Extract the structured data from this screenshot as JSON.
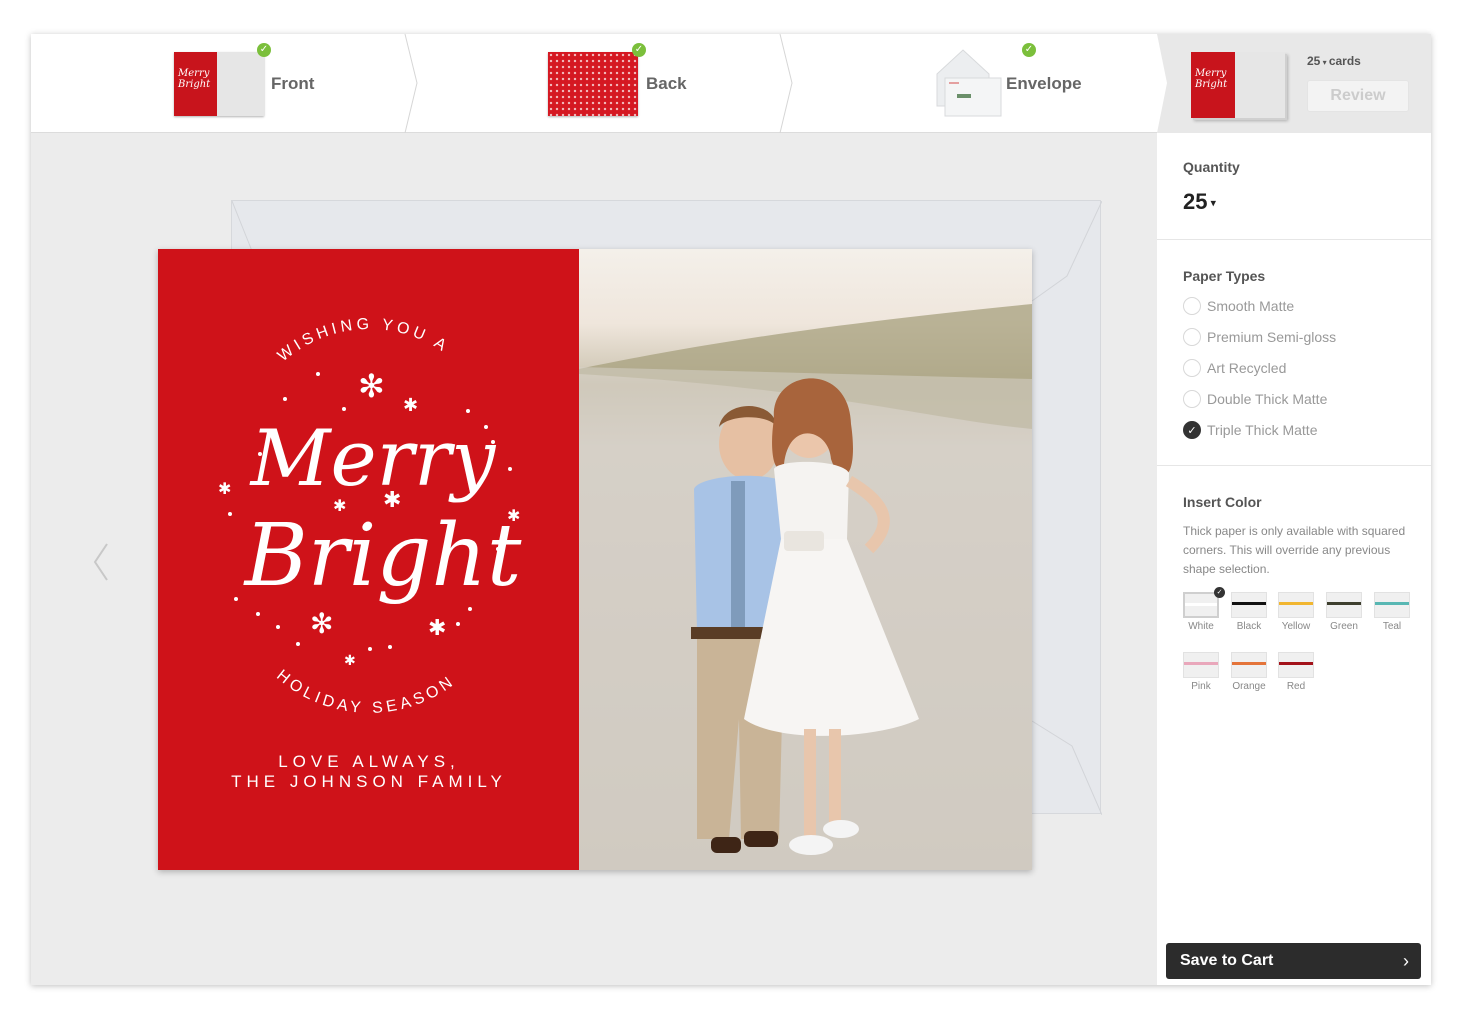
{
  "steps": [
    {
      "label": "Front",
      "complete": true
    },
    {
      "label": "Back",
      "complete": true
    },
    {
      "label": "Envelope",
      "complete": true
    }
  ],
  "review": {
    "quantity": "25",
    "quantity_unit": "cards",
    "button_label": "Review"
  },
  "card": {
    "top_arc": "WISHING YOU A",
    "script_line1": "Merry",
    "script_line2": "Bright",
    "bottom_arc": "HOLIDAY SEASON",
    "signoff_line1": "LOVE ALWAYS,",
    "signoff_line2": "THE JOHNSON FAMILY",
    "red_color": "#cf1219"
  },
  "panel": {
    "quantity_title": "Quantity",
    "quantity_value": "25",
    "paper_types_title": "Paper Types",
    "paper_types": [
      {
        "label": "Smooth Matte",
        "selected": false
      },
      {
        "label": "Premium Semi-gloss",
        "selected": false
      },
      {
        "label": "Art Recycled",
        "selected": false
      },
      {
        "label": "Double Thick Matte",
        "selected": false
      },
      {
        "label": "Triple Thick Matte",
        "selected": true
      }
    ],
    "insert_color_title": "Insert Color",
    "insert_note": "Thick paper is only available with squared corners. This will override any previous shape selection.",
    "insert_colors": [
      {
        "label": "White",
        "color": "#ffffff",
        "selected": true
      },
      {
        "label": "Black",
        "color": "#111111",
        "selected": false
      },
      {
        "label": "Yellow",
        "color": "#f1b630",
        "selected": false
      },
      {
        "label": "Green",
        "color": "#3e3f2e",
        "selected": false
      },
      {
        "label": "Teal",
        "color": "#58b7b3",
        "selected": false
      },
      {
        "label": "Pink",
        "color": "#e9a7bb",
        "selected": false
      },
      {
        "label": "Orange",
        "color": "#e4743a",
        "selected": false
      },
      {
        "label": "Red",
        "color": "#a3121a",
        "selected": false
      }
    ],
    "save_label": "Save to Cart"
  }
}
